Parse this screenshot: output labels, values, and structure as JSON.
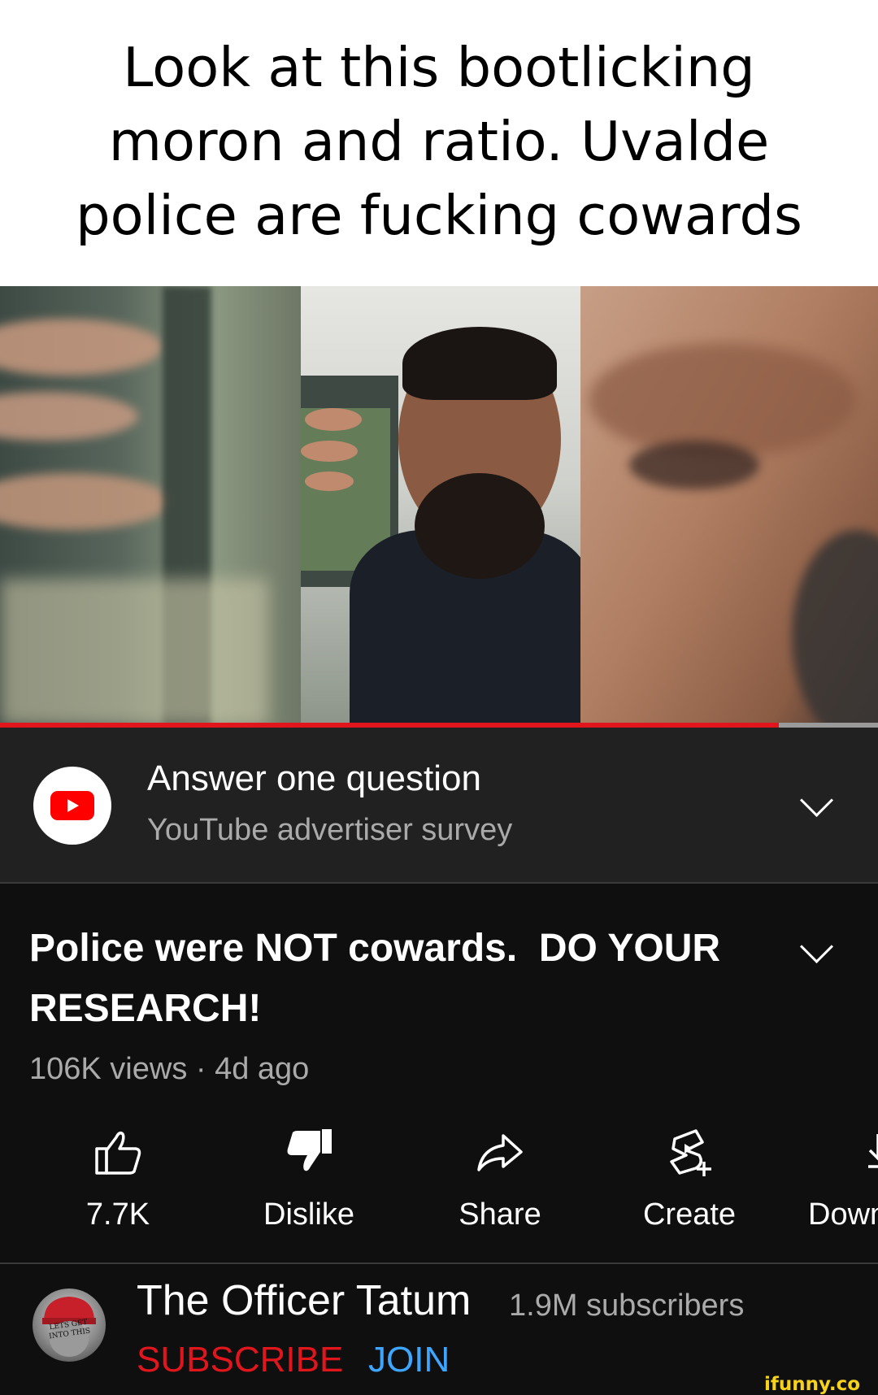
{
  "caption": {
    "line1": "Look at this bootlicking",
    "line2": "moron and ratio. Uvalde",
    "line3": "police are fucking cowards"
  },
  "video": {
    "progress_fraction": 0.887
  },
  "survey": {
    "title": "Answer one question",
    "subtitle": "YouTube advertiser survey",
    "logo_icon": "youtube-logo-icon",
    "expand_icon": "chevron-down-icon"
  },
  "details": {
    "title_line1": "Police were NOT cowards.  DO YOUR",
    "title_line2": "RESEARCH!",
    "meta": "106K views · 4d ago",
    "expand_icon": "chevron-down-icon"
  },
  "actions": [
    {
      "label": "7.7K",
      "icon": "thumbs-up-icon"
    },
    {
      "label": "Dislike",
      "icon": "thumbs-down-icon"
    },
    {
      "label": "Share",
      "icon": "share-icon"
    },
    {
      "label": "Create",
      "icon": "create-icon"
    },
    {
      "label": "Down",
      "icon": "download-icon"
    }
  ],
  "channel": {
    "name": "The Officer Tatum",
    "subscribers": "1.9M subscribers",
    "subscribe_label": "SUBSCRIBE",
    "join_label": "JOIN",
    "avatar_text": "LETS GET INTO THIS"
  },
  "watermark": "ifunny.co",
  "colors": {
    "accent_red": "#e1161d",
    "join_blue": "#3ea6ff",
    "watermark_yellow": "#f6d21b"
  }
}
